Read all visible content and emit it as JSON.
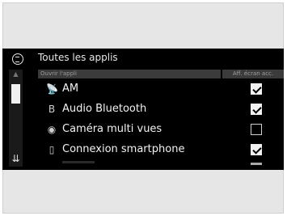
{
  "header": {
    "title": "Toutes les applis"
  },
  "columns": {
    "left": "Ouvrir l'appli",
    "right": "Aff. écran acc."
  },
  "scrollbar": {
    "up_icon": "chevron-up-icon",
    "down_icon": "double-chevron-down-icon"
  },
  "apps": [
    {
      "label": "AM",
      "icon": "radio-icon",
      "checked": true
    },
    {
      "label": "Audio Bluetooth",
      "icon": "bluetooth-icon",
      "checked": true
    },
    {
      "label": "Caméra multi vues",
      "icon": "camera-icon",
      "checked": false
    },
    {
      "label": "Connexion smartphone",
      "icon": "smartphone-icon",
      "checked": true
    }
  ]
}
